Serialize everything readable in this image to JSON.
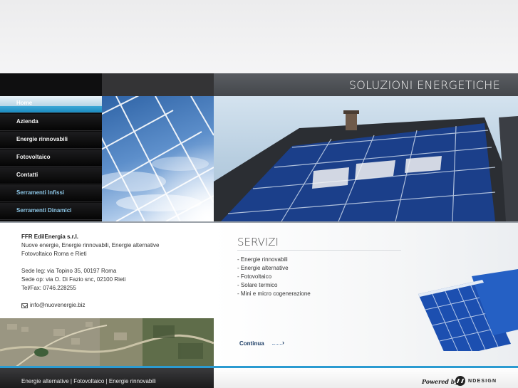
{
  "header": {
    "title": "SOLUZIONI ENERGETICHE"
  },
  "nav": {
    "items": [
      {
        "label": "Home"
      },
      {
        "label": "Azienda"
      },
      {
        "label": "Energie rinnovabili"
      },
      {
        "label": "Fotovoltaico"
      },
      {
        "label": "Contatti"
      },
      {
        "label": "Serramenti Infissi"
      },
      {
        "label": "Serramenti Dinamici"
      }
    ]
  },
  "company": {
    "name": "FFR EdilEnergia s.r.l.",
    "tagline1": "Nuove energie, Energie rinnovabili, Energie alternative",
    "tagline2": "Fotovoltaico Roma e Rieti",
    "sede_leg": "Sede leg: via Topino 35, 00197 Roma",
    "sede_op": "Sede op: via O. Di Fazio snc, 02100 Rieti",
    "tel": "Tel/Fax: 0746.228255",
    "email": "info@nuovenergie.biz"
  },
  "servizi": {
    "title": "SERVIZI",
    "items": [
      "- Energie rinnovabili",
      "- Energie alternative",
      "- Fotovoltaico",
      "- Solare termico",
      "- Mini e micro cogenerazione"
    ],
    "continua": "Continua"
  },
  "footer": {
    "links": "Energie alternative | Fotovoltaico | Energie rinnovabili",
    "powered_by": "Powered by",
    "brand": "NDESIGN"
  },
  "icons": {
    "mail": "mail-icon",
    "arrow": "chevron-right-icon"
  },
  "colors": {
    "accent": "#2b9bd1",
    "nav_bg": "#0b0b0c",
    "highlight_nav": "#8cc6e6"
  }
}
